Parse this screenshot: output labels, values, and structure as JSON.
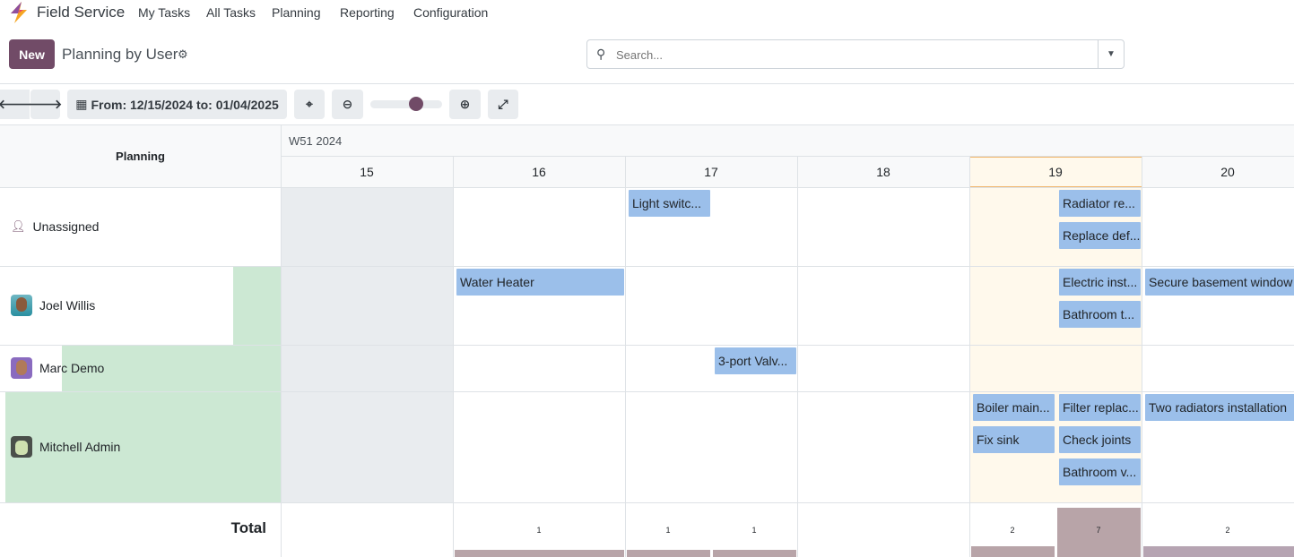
{
  "nav": {
    "app_name": "Field Service",
    "menu": [
      "My Tasks",
      "All Tasks",
      "Planning",
      "Reporting",
      "Configuration"
    ]
  },
  "control": {
    "new_label": "New",
    "title": "Planning by User",
    "search_placeholder": "Search..."
  },
  "toolbar": {
    "date_range": "From: 12/15/2024 to: 01/04/2025",
    "zoom_level": 0.6
  },
  "gantt": {
    "header_label": "Planning",
    "week": "W51 2024",
    "days": [
      "15",
      "16",
      "17",
      "18",
      "19",
      "20"
    ],
    "today": "19",
    "rows": [
      {
        "name": "Unassigned",
        "workload": null
      },
      {
        "name": "Joel Willis",
        "workload": 0.17
      },
      {
        "name": "Marc Demo",
        "workload": 0.78
      },
      {
        "name": "Mitchell Admin",
        "workload": 0.98
      }
    ],
    "pills": {
      "light_switch": "Light switc...",
      "radiator": "Radiator re...",
      "replace": "Replace def...",
      "water_heater": "Water Heater",
      "electric": "Electric inst...",
      "bathroom_t": "Bathroom t...",
      "secure": "Secure basement window",
      "valve": "3-port Valv...",
      "boiler": "Boiler main...",
      "fix_sink": "Fix sink",
      "filter": "Filter replac...",
      "check_joints": "Check joints",
      "bathroom_v": "Bathroom v...",
      "two_radiators": "Two radiators installation"
    },
    "total_label": "Total",
    "totals": [
      {
        "slot": "16",
        "count": "1"
      },
      {
        "slot": "17 AM",
        "count": "1"
      },
      {
        "slot": "17 PM",
        "count": "1"
      },
      {
        "slot": "19 AM",
        "count": "2"
      },
      {
        "slot": "19 PM",
        "count": "7"
      },
      {
        "slot": "20",
        "count": "2"
      }
    ]
  },
  "colors": {
    "brand": "#714b67",
    "pill": "#9bbfea",
    "workload": "#cce8d3",
    "today": "#fff9ec",
    "today_border": "#f0b56a",
    "weekend": "#e9ecef",
    "total_bar": "#b8a4a8"
  }
}
